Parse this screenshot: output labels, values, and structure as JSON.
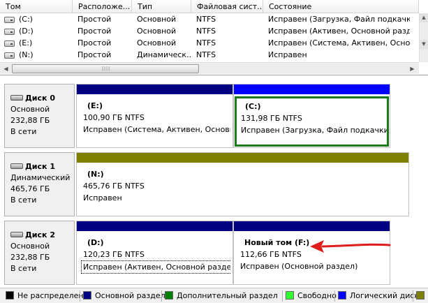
{
  "columns": [
    "Том",
    "Расположе...",
    "Тип",
    "Файловая сист...",
    "Состояние"
  ],
  "volumes": [
    {
      "name": "(C:)",
      "layout": "Простой",
      "type": "Основной",
      "fs": "NTFS",
      "status": "Исправен (Загрузка, Файл подкачки,"
    },
    {
      "name": "(D:)",
      "layout": "Простой",
      "type": "Основной",
      "fs": "NTFS",
      "status": "Исправен (Активен, Основной разде"
    },
    {
      "name": "(E:)",
      "layout": "Простой",
      "type": "Основной",
      "fs": "NTFS",
      "status": "Исправен (Система, Активен, Основ"
    },
    {
      "name": "(N:)",
      "layout": "Простой",
      "type": "Динамическ...",
      "fs": "NTFS",
      "status": "Исправен"
    }
  ],
  "disks": [
    {
      "name": "Диск 0",
      "kind": "Основной",
      "size": "232,88 ГБ",
      "state": "В сети",
      "partitions": [
        {
          "label": "(E:)",
          "size_fs": "100,90 ГБ NTFS",
          "status": "Исправен (Система, Активен, Основн",
          "bar_color": "#000080"
        },
        {
          "label": "(C:)",
          "size_fs": "131,98 ГБ NTFS",
          "status": "Исправен (Загрузка, Файл подкачки,",
          "bar_color": "#0000ff"
        }
      ]
    },
    {
      "name": "Диск 1",
      "kind": "Динамический",
      "size": "465,76 ГБ",
      "state": "В сети",
      "partitions": [
        {
          "label": "(N:)",
          "size_fs": "465,76 ГБ NTFS",
          "status": "Исправен",
          "bar_color": "#808000"
        }
      ]
    },
    {
      "name": "Диск 2",
      "kind": "Основной",
      "size": "232,88 ГБ",
      "state": "В сети",
      "partitions": [
        {
          "label": "(D:)",
          "size_fs": "120,23 ГБ NTFS",
          "status": "Исправен (Активен, Основной раздел)",
          "bar_color": "#000080"
        },
        {
          "label": "Новый том  (F:)",
          "size_fs": "112,66 ГБ NTFS",
          "status": "Исправен (Основной раздел)",
          "bar_color": "#000080"
        }
      ]
    }
  ],
  "legend": [
    {
      "label": "Не распределен",
      "color": "#000000"
    },
    {
      "label": "Основной раздел",
      "color": "#000080"
    },
    {
      "label": "Дополнительный раздел",
      "color": "#008000"
    },
    {
      "label": "Свободно",
      "color": "#33ff33"
    },
    {
      "label": "Логический диск",
      "color": "#0000ff"
    }
  ]
}
